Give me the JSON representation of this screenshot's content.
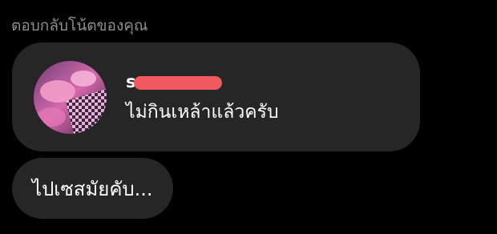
{
  "header": {
    "title": "ตอบกลับโน้ตของคุณ"
  },
  "note": {
    "avatar_icon": "profile-photo-avatar",
    "username": "s",
    "username_redacted": true,
    "redaction_color": "#f05a5e",
    "text": "ไม่กินเหล้าแล้วครับ"
  },
  "reply": {
    "text": "ไปเซสมัยคับ..."
  },
  "colors": {
    "background": "#000000",
    "bubble": "#262626",
    "muted_text": "#8e8e8e",
    "text": "#ffffff"
  }
}
